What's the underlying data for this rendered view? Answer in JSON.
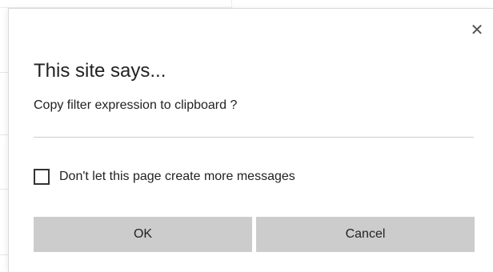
{
  "dialog": {
    "title": "This site says...",
    "message": "Copy filter expression to clipboard ?",
    "close_glyph": "✕",
    "checkbox_label": "Don't let this page create more messages",
    "checkbox_checked": false,
    "ok_label": "OK",
    "cancel_label": "Cancel"
  },
  "colors": {
    "button_bg": "#cccccc",
    "text": "#222222",
    "divider": "#cccccc"
  }
}
